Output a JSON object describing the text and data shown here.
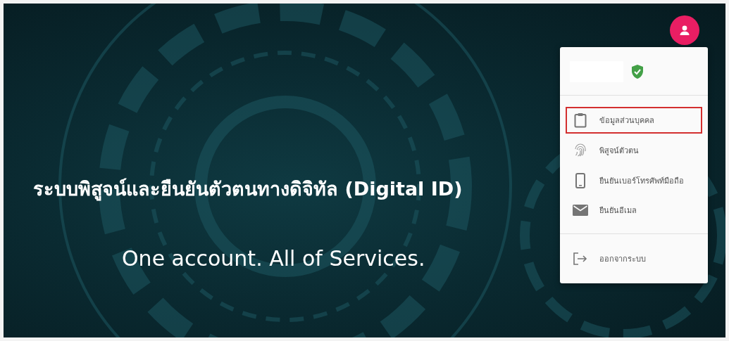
{
  "hero": {
    "title": "ระบบพิสูจน์และยืนยันตัวตนทางดิจิทัล (Digital ID)",
    "subtitle": "One account. All of Services."
  },
  "account_menu": {
    "verified": true,
    "items": [
      {
        "kind": "profile",
        "label": "ข้อมูลส่วนบุคคล",
        "selected": true
      },
      {
        "kind": "identity",
        "label": "พิสูจน์ตัวตน",
        "selected": false
      },
      {
        "kind": "phone",
        "label": "ยืนยันเบอร์โทรศัพท์มือถือ",
        "selected": false
      },
      {
        "kind": "email",
        "label": "ยืนยันอีเมล",
        "selected": false
      }
    ],
    "logout": {
      "label": "ออกจากระบบ"
    }
  }
}
